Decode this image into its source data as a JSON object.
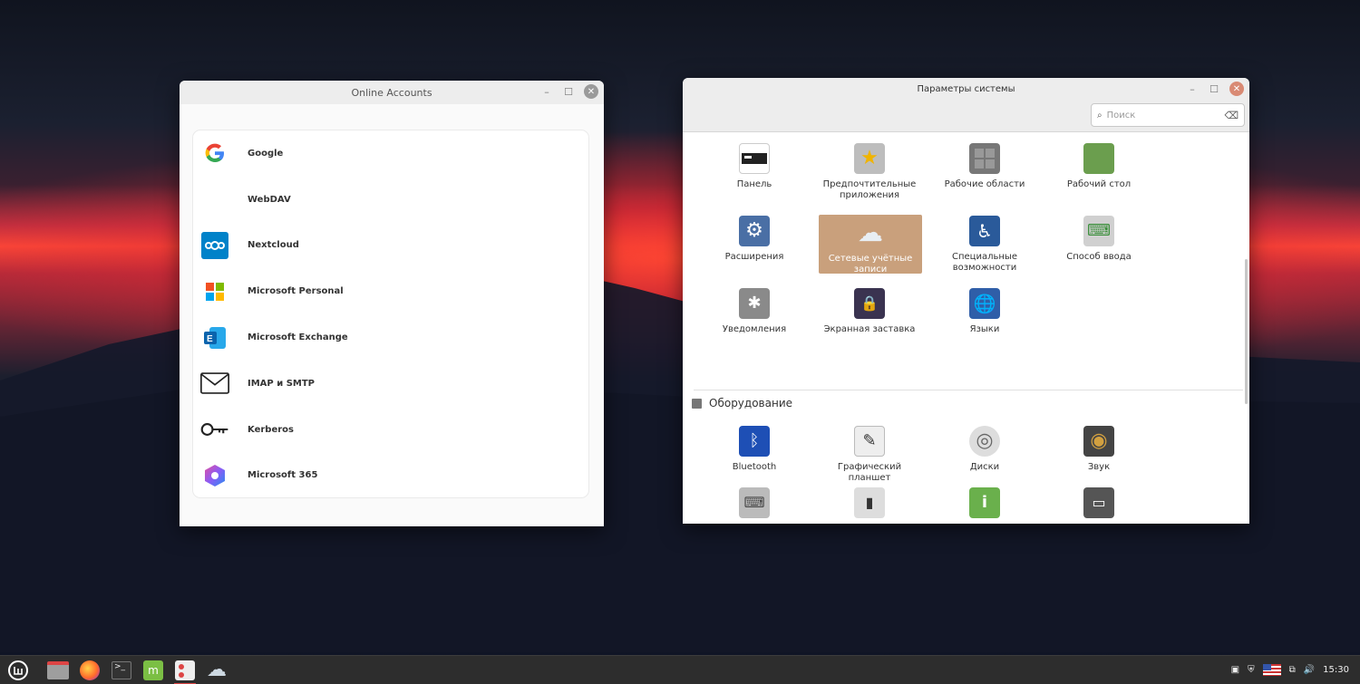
{
  "online_accounts": {
    "title": "Online Accounts",
    "accounts": [
      {
        "label": "Google",
        "icon": "google-icon"
      },
      {
        "label": "WebDAV",
        "icon": ""
      },
      {
        "label": "Nextcloud",
        "icon": "nextcloud-icon"
      },
      {
        "label": "Microsoft Personal",
        "icon": "microsoft-icon"
      },
      {
        "label": "Microsoft Exchange",
        "icon": "exchange-icon"
      },
      {
        "label": "IMAP и SMTP",
        "icon": "mail-icon"
      },
      {
        "label": "Kerberos",
        "icon": "key-icon"
      },
      {
        "label": "Microsoft 365",
        "icon": "microsoft365-icon"
      }
    ]
  },
  "settings": {
    "title": "Параметры системы",
    "search_placeholder": "Поиск",
    "items": [
      {
        "label": "Панель",
        "icon": "panel-icon"
      },
      {
        "label": "Предпочтительные приложения",
        "icon": "star-icon"
      },
      {
        "label": "Рабочие области",
        "icon": "workspaces-icon"
      },
      {
        "label": "Рабочий стол",
        "icon": "desktop-icon"
      },
      {
        "label": "Расширения",
        "icon": "gear-icon"
      },
      {
        "label": "Сетевые учётные записи",
        "icon": "cloud-icon"
      },
      {
        "label": "Специальные возможности",
        "icon": "accessibility-icon"
      },
      {
        "label": "Способ ввода",
        "icon": "keyboard-icon"
      },
      {
        "label": "Уведомления",
        "icon": "notification-icon"
      },
      {
        "label": "Экранная заставка",
        "icon": "lock-icon"
      },
      {
        "label": "Языки",
        "icon": "globe-icon"
      }
    ],
    "hardware_section": "Оборудование",
    "hardware": [
      {
        "label": "Bluetooth",
        "icon": "bluetooth-icon"
      },
      {
        "label": "Графический планшет",
        "icon": "tablet-icon"
      },
      {
        "label": "Диски",
        "icon": "disk-icon"
      },
      {
        "label": "Звук",
        "icon": "speaker-icon"
      }
    ]
  },
  "taskbar": {
    "clock": "15:30"
  },
  "colors": {
    "selection": "#c9a07c",
    "close_button": "#9a9a9a"
  }
}
